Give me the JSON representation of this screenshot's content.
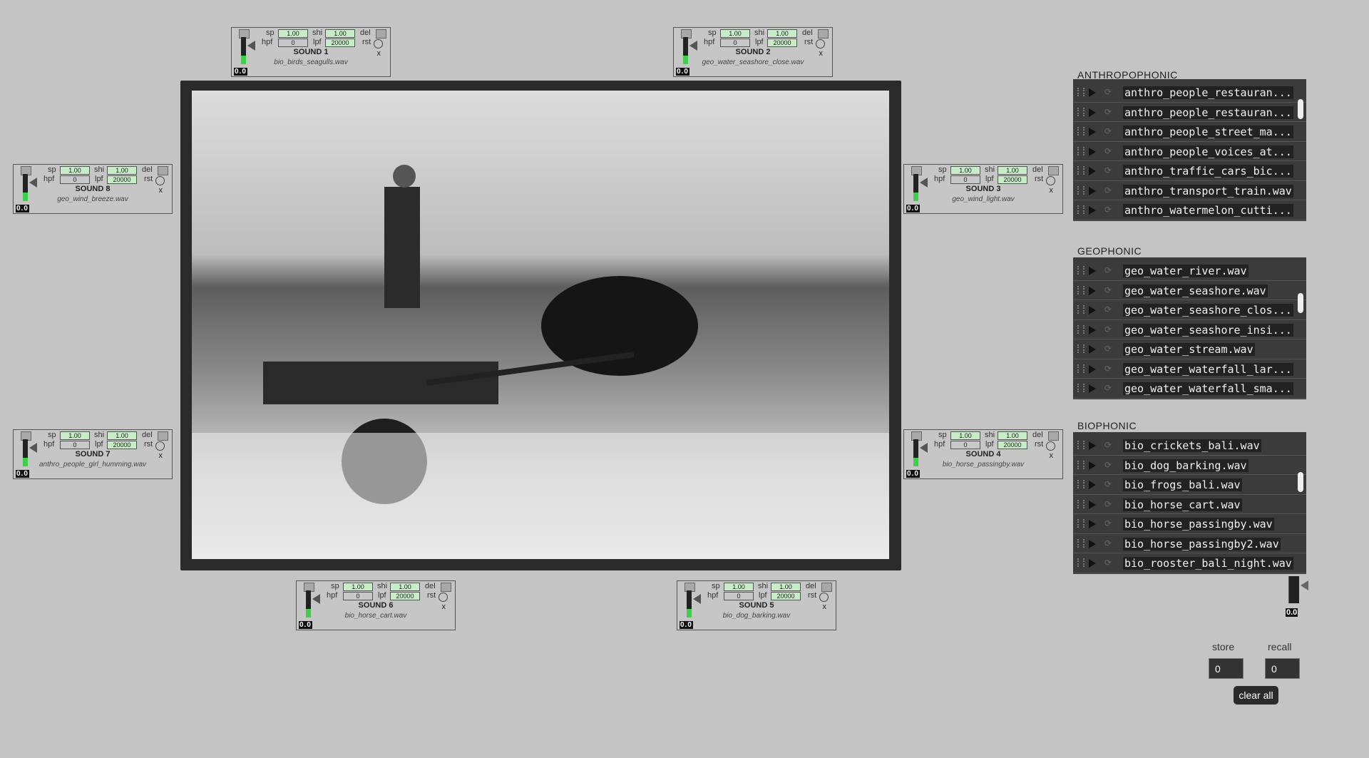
{
  "panel_labels": {
    "sp": "sp",
    "shi": "shi",
    "del": "del",
    "hpf": "hpf",
    "lpf": "lpf",
    "rst": "rst",
    "x": "x",
    "level": "0.0"
  },
  "sounds": [
    {
      "title": "SOUND 1",
      "file": "bio_birds_seagulls.wav",
      "sp": "1.00",
      "shi": "1.00",
      "hpf": "0",
      "lpf": "20000"
    },
    {
      "title": "SOUND 2",
      "file": "geo_water_seashore_close.wav",
      "sp": "1.00",
      "shi": "1.00",
      "hpf": "0",
      "lpf": "20000"
    },
    {
      "title": "SOUND 8",
      "file": "geo_wind_breeze.wav",
      "sp": "1.00",
      "shi": "1.00",
      "hpf": "0",
      "lpf": "20000"
    },
    {
      "title": "SOUND 3",
      "file": "geo_wind_light.wav",
      "sp": "1.00",
      "shi": "1.00",
      "hpf": "0",
      "lpf": "20000"
    },
    {
      "title": "SOUND 7",
      "file": "anthro_people_girl_humming.wav",
      "sp": "1.00",
      "shi": "1.00",
      "hpf": "0",
      "lpf": "20000"
    },
    {
      "title": "SOUND 4",
      "file": "bio_horse_passingby.wav",
      "sp": "1.00",
      "shi": "1.00",
      "hpf": "0",
      "lpf": "20000"
    },
    {
      "title": "SOUND 6",
      "file": "bio_horse_cart.wav",
      "sp": "1.00",
      "shi": "1.00",
      "hpf": "0",
      "lpf": "20000"
    },
    {
      "title": "SOUND 5",
      "file": "bio_dog_barking.wav",
      "sp": "1.00",
      "shi": "1.00",
      "hpf": "0",
      "lpf": "20000"
    }
  ],
  "libraries": [
    {
      "title": "ANTHROPOPHONIC",
      "items": [
        "anthro_people_restauran...",
        "anthro_people_restauran...",
        "anthro_people_street_ma...",
        "anthro_people_voices_at...",
        "anthro_traffic_cars_bic...",
        "anthro_transport_train.wav",
        "anthro_watermelon_cutti..."
      ]
    },
    {
      "title": "GEOPHONIC",
      "items": [
        "geo_water_river.wav",
        "geo_water_seashore.wav",
        "geo_water_seashore_clos...",
        "geo_water_seashore_insi...",
        "geo_water_stream.wav",
        "geo_water_waterfall_lar...",
        "geo_water_waterfall_sma..."
      ]
    },
    {
      "title": "BIOPHONIC",
      "items": [
        "bio_crickets_bali.wav",
        "bio_dog_barking.wav",
        "bio_frogs_bali.wav",
        "bio_horse_cart.wav",
        "bio_horse_passingby.wav",
        "bio_horse_passingby2.wav",
        "bio_rooster_bali_night.wav"
      ]
    }
  ],
  "master": {
    "level": "0.0"
  },
  "presets": {
    "store_label": "store",
    "store_value": "0",
    "recall_label": "recall",
    "recall_value": "0",
    "clear_label": "clear all"
  },
  "colors": {
    "meter": "#3bd24a",
    "field_active": "#c8ecc8"
  }
}
